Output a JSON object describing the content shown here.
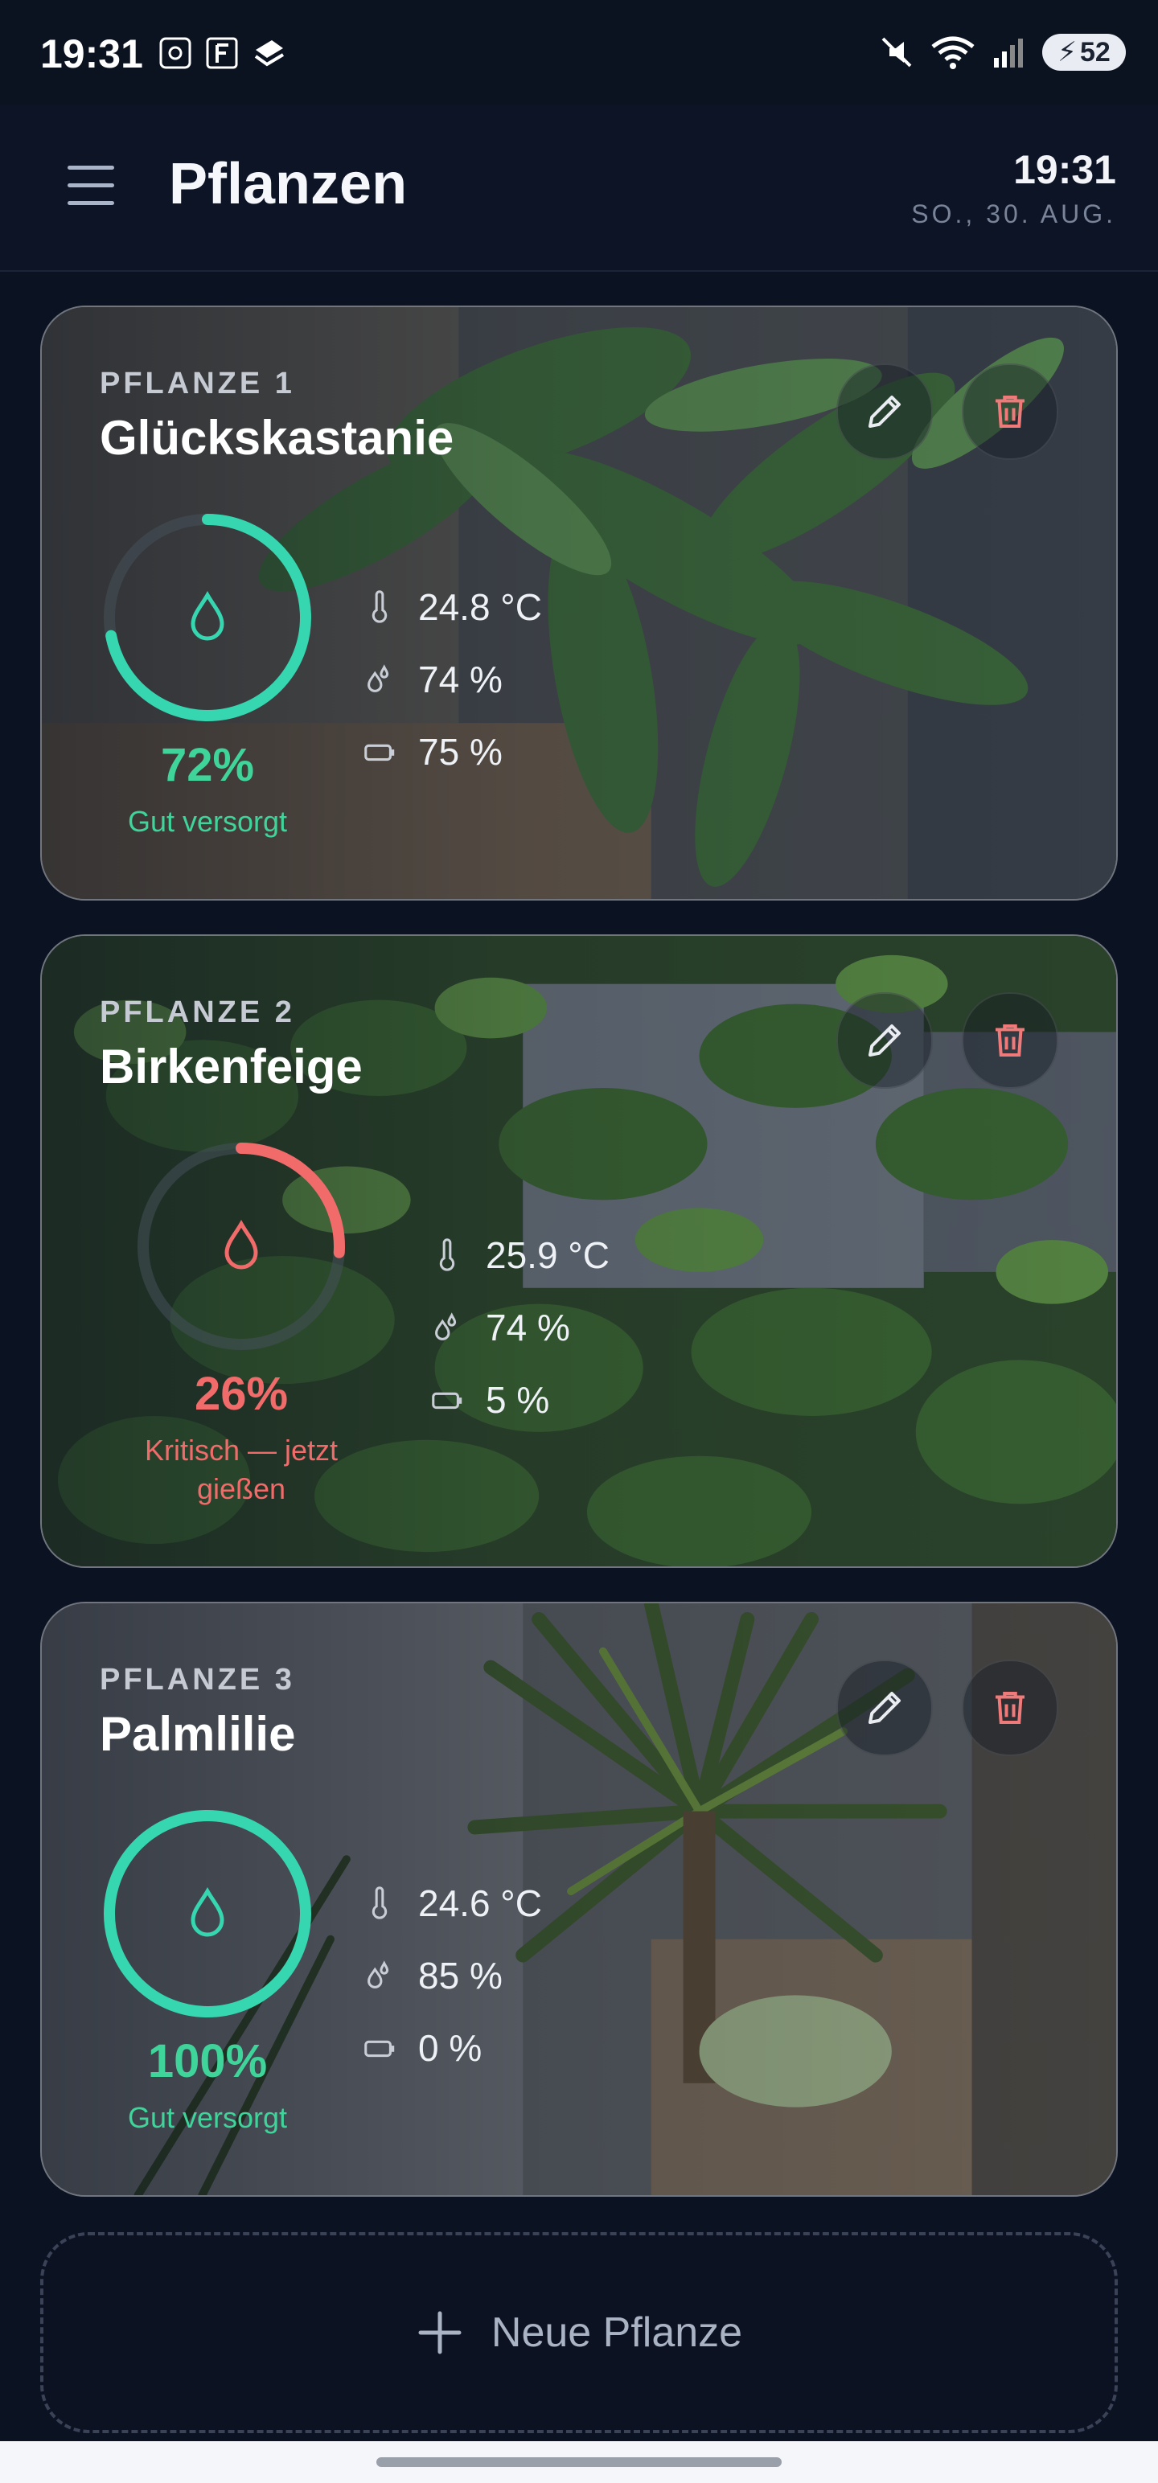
{
  "status_bar": {
    "time": "19:31",
    "battery": "52"
  },
  "header": {
    "title": "Pflanzen",
    "time": "19:31",
    "date": "SO., 30. AUG."
  },
  "plants": [
    {
      "label": "PFLANZE 1",
      "name": "Glückskastanie",
      "percent": "72%",
      "level": 0.72,
      "status": "Gut versorgt",
      "temperature": "24.8 °C",
      "humidity": "74 %",
      "battery": "75 %"
    },
    {
      "label": "PFLANZE 2",
      "name": "Birkenfeige",
      "percent": "26%",
      "level": 0.26,
      "status": "Kritisch — jetzt gießen",
      "temperature": "25.9 °C",
      "humidity": "74 %",
      "battery": "5 %"
    },
    {
      "label": "PFLANZE 3",
      "name": "Palmlilie",
      "percent": "100%",
      "level": 1.0,
      "status": "Gut versorgt",
      "temperature": "24.6 °C",
      "humidity": "85 %",
      "battery": "0 %"
    }
  ],
  "add_button": {
    "label": "Neue Pflanze"
  },
  "colors": {
    "good": "#35d6b0",
    "good_text": "#3fd49a",
    "critical": "#f26b6b",
    "ring_track": "rgba(70,80,90,0.55)"
  },
  "icons": [
    "menu-icon",
    "pencil-icon",
    "trash-icon",
    "thermometer-icon",
    "humidity-icon",
    "battery-icon",
    "water-drop-icon",
    "plus-icon"
  ]
}
